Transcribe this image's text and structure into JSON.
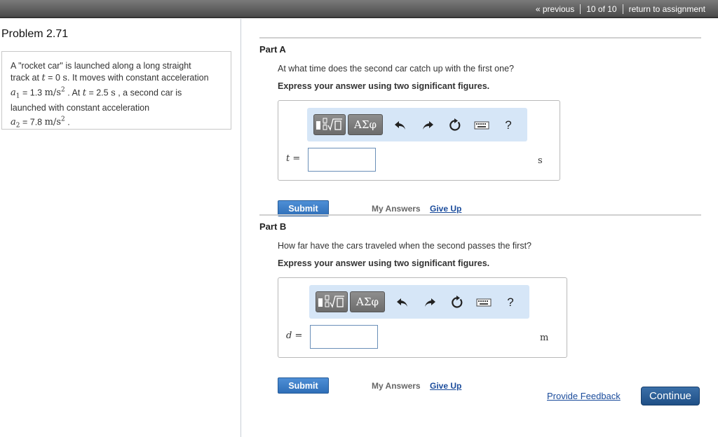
{
  "nav": {
    "previous": "« previous",
    "counter": "10 of 10",
    "return": "return to assignment"
  },
  "problem": {
    "title": "Problem 2.71",
    "text_1": "A \"rocket car\" is launched along a long straight",
    "text_2a": "track at ",
    "t_var": "t",
    "text_2b": " = 0 ",
    "s_unit": "s",
    "text_2c": ". It moves with constant acceleration",
    "a1_var": "a",
    "a1_sub": "1",
    "a1_val": " = 1.3 ",
    "a1_unit": "m/s",
    "sq": "2",
    "text_3b": " . At ",
    "text_3c": " = 2.5 ",
    "text_3d": " , a second car is",
    "text_4": "launched with constant acceleration",
    "a2_var": "a",
    "a2_sub": "2",
    "a2_val": " = 7.8 ",
    "a2_unit": "m/s",
    "text_5": " ."
  },
  "parts": [
    {
      "title": "Part A",
      "question": "At what time does the second car catch up with the first one?",
      "instruction": "Express your answer using two significant figures.",
      "var": "t",
      "eq": " =",
      "unit": "s",
      "value": "",
      "submit": "Submit",
      "my_answers": "My Answers",
      "give_up": "Give Up"
    },
    {
      "title": "Part B",
      "question": "How far have the cars traveled when the second passes the first?",
      "instruction": "Express your answer using two significant figures.",
      "var": "d",
      "eq": " =",
      "unit": "m",
      "value": "",
      "submit": "Submit",
      "my_answers": "My Answers",
      "give_up": "Give Up"
    }
  ],
  "toolbar": {
    "greek_label": "ΑΣφ",
    "help_label": "?"
  },
  "footer": {
    "feedback": "Provide Feedback",
    "continue": "Continue"
  }
}
